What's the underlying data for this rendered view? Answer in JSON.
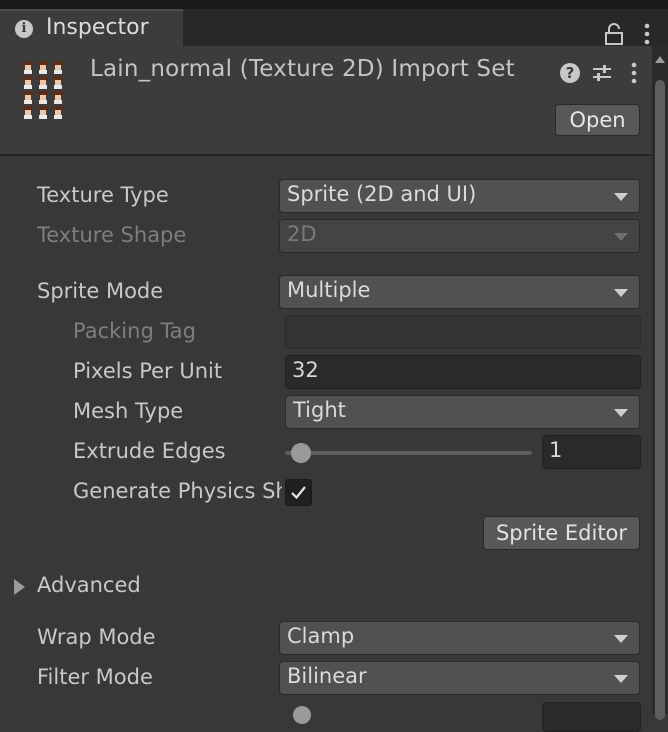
{
  "tab": {
    "title": "Inspector",
    "icon": "info-icon"
  },
  "header": {
    "title": "Lain_normal (Texture 2D) Import Set",
    "open_label": "Open"
  },
  "fields": {
    "texture_type": {
      "label": "Texture Type",
      "value": "Sprite (2D and UI)"
    },
    "texture_shape": {
      "label": "Texture Shape",
      "value": "2D"
    },
    "sprite_mode": {
      "label": "Sprite Mode",
      "value": "Multiple"
    },
    "packing_tag": {
      "label": "Packing Tag",
      "value": ""
    },
    "pixels_per_unit": {
      "label": "Pixels Per Unit",
      "value": "32"
    },
    "mesh_type": {
      "label": "Mesh Type",
      "value": "Tight"
    },
    "extrude_edges": {
      "label": "Extrude Edges",
      "value": "1",
      "slider_fraction": 0.0
    },
    "generate_physics": {
      "label": "Generate Physics Shape",
      "checked": true
    },
    "sprite_editor_label": "Sprite Editor",
    "advanced_label": "Advanced",
    "wrap_mode": {
      "label": "Wrap Mode",
      "value": "Clamp"
    },
    "filter_mode": {
      "label": "Filter Mode",
      "value": "Bilinear"
    }
  },
  "colors": {
    "background": "#383838",
    "field_bg": "#515151",
    "text": "#c8c8c8",
    "disabled_text": "#7e7e7e"
  }
}
